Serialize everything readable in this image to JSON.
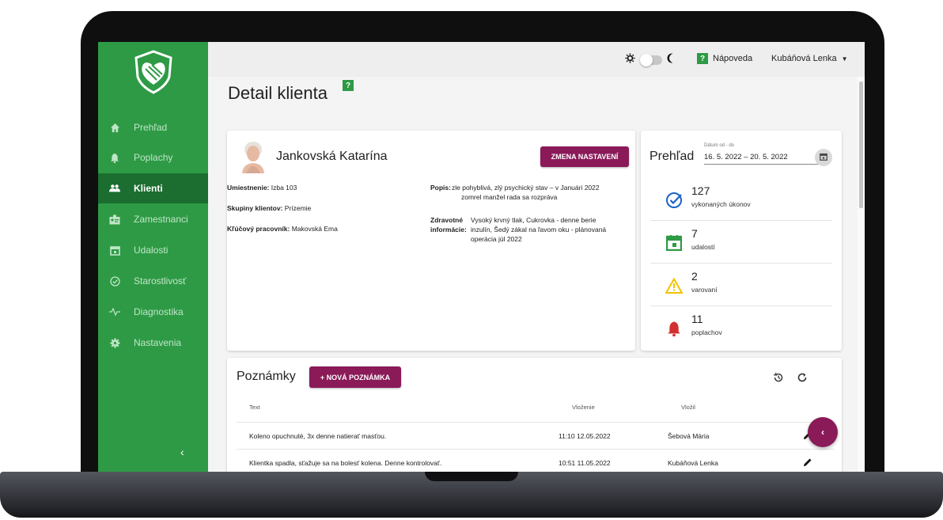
{
  "colors": {
    "brand_green": "#2e9a45",
    "active_nav": "#1b6e2f",
    "accent": "#8a1a58"
  },
  "sidebar": {
    "items": [
      {
        "label": "Prehľad",
        "icon": "home-icon"
      },
      {
        "label": "Poplachy",
        "icon": "bell-icon"
      },
      {
        "label": "Klienti",
        "icon": "people-icon",
        "active": true
      },
      {
        "label": "Zamestnanci",
        "icon": "badge-icon"
      },
      {
        "label": "Udalosti",
        "icon": "calendar-icon"
      },
      {
        "label": "Starostlivosť",
        "icon": "check-circle-icon"
      },
      {
        "label": "Diagnostika",
        "icon": "pulse-icon"
      },
      {
        "label": "Nastavenia",
        "icon": "gear-icon"
      }
    ],
    "collapse_label": "‹"
  },
  "topbar": {
    "help_label": "Nápoveda",
    "help_icon": "?",
    "user_name": "Kubáňová Lenka"
  },
  "page": {
    "title": "Detail klienta",
    "help_icon": "?"
  },
  "client": {
    "name": "Jankovská Katarína",
    "edit_button": "ZMENA NASTAVENÍ",
    "umiestnenie_label": "Umiestnenie:",
    "umiestnenie": "Izba 103",
    "skupiny_label": "Skupiny klientov:",
    "skupiny": "Prízemie",
    "pracovnik_label": "Kľúčový pracovník:",
    "pracovnik": "Makovská Ema",
    "popis_label": "Popis:",
    "popis_1": "zle pohyblivá, zlý psychický stav – v Januári 2022",
    "popis_2": "zomrel manžel rada sa rozpráva",
    "zdrav_label_1": "Zdravotné",
    "zdrav_label_2": "informácie:",
    "zdrav_1": "Vysoký krvný tlak, Cukrovka - denne berie",
    "zdrav_2": "inzulín, Šedý zákal na ľavom oku - plánovaná",
    "zdrav_3": "operácia júl 2022"
  },
  "overview": {
    "title": "Prehľad",
    "date_label": "Dátum od - do",
    "date_range": "16. 5. 2022 – 20. 5. 2022",
    "stats": [
      {
        "value": "127",
        "label": "vykonaných úkonov",
        "icon": "check-circle-icon",
        "color": "#1a63c9"
      },
      {
        "value": "7",
        "label": "udalostí",
        "icon": "calendar-icon",
        "color": "#2e9a45"
      },
      {
        "value": "2",
        "label": "varovaní",
        "icon": "warning-icon",
        "color": "#f2c200"
      },
      {
        "value": "11",
        "label": "poplachov",
        "icon": "bell-icon",
        "color": "#d32f2f"
      }
    ]
  },
  "notes": {
    "title": "Poznámky",
    "add_button": "+ NOVÁ POZNÁMKA",
    "columns": {
      "text": "Text",
      "inserted": "Vloženie",
      "author": "Vložil"
    },
    "rows": [
      {
        "text": "Koleno opuchnuté, 3x denne natierať masťou.",
        "inserted": "11:10 12.05.2022",
        "author": "Šebová Mária"
      },
      {
        "text": "Klientka spadla, sťažuje sa na bolesť kolena. Denne kontrolovať.",
        "inserted": "10:51 11.05.2022",
        "author": "Kubáňová Lenka"
      }
    ]
  },
  "fab_label": "‹"
}
